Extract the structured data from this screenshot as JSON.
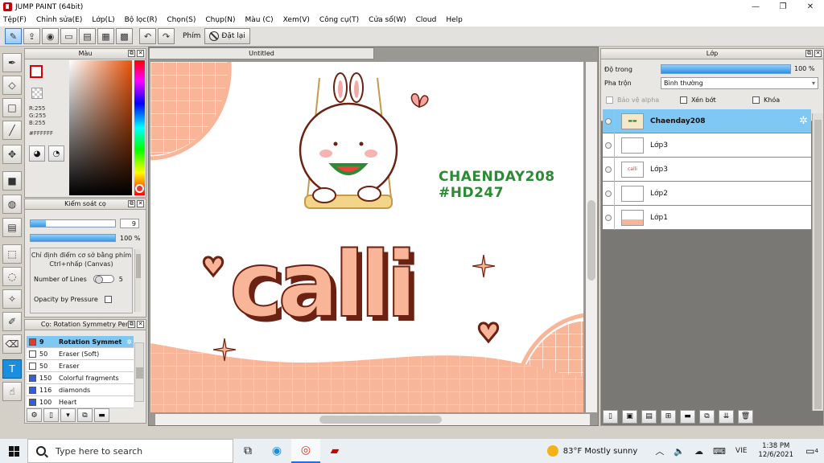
{
  "window": {
    "title": "JUMP PAINT (64bit)",
    "minimize": "—",
    "maximize": "❐",
    "close": "✕"
  },
  "menu": [
    "Tệp(F)",
    "Chỉnh sửa(E)",
    "Lớp(L)",
    "Bộ lọc(R)",
    "Chọn(S)",
    "Chụp(N)",
    "Màu (C)",
    "Xem(V)",
    "Công cụ(T)",
    "Cửa sổ(W)",
    "Cloud",
    "Help"
  ],
  "toolbar": {
    "key_label": "Phím",
    "reset_label": "Đặt lại"
  },
  "color_panel": {
    "title": "Màu",
    "r": "R:255",
    "g": "G:255",
    "b": "B:255",
    "hex": "#FFFFFF",
    "primary_color": "#FFFFFF",
    "hue_color": "#E8540A"
  },
  "brush_control": {
    "title": "Kiểm soát cọ",
    "size_value": "9",
    "size_fraction": 0.18,
    "opacity_value": "100 %",
    "opacity_fraction": 1.0,
    "description": "Chỉ định điểm cơ sở bằng phím Ctrl+nhấp (Canvas)",
    "lines_label": "Number of Lines",
    "lines_value": "5",
    "pressure_label": "Opacity by Pressure"
  },
  "brush_list": {
    "title": "Cọ: Rotation Symmetry Pen",
    "items": [
      {
        "color": "#E8392F",
        "size": "9",
        "name": "Rotation Symmet",
        "selected": true
      },
      {
        "color": "#FFFFFF",
        "size": "50",
        "name": "Eraser (Soft)",
        "selected": false
      },
      {
        "color": "#FFFFFF",
        "size": "50",
        "name": "Eraser",
        "selected": false
      },
      {
        "color": "#2F5FE8",
        "size": "150",
        "name": "Colorful fragments",
        "selected": false
      },
      {
        "color": "#2F5FE8",
        "size": "116",
        "name": "diamonds",
        "selected": false
      },
      {
        "color": "#2F5FE8",
        "size": "100",
        "name": "Heart",
        "selected": false
      }
    ]
  },
  "canvas": {
    "tab_label": "Untitled",
    "text_line1": "CHAENDAY208",
    "text_line2": "#HD247",
    "art_word": "calli",
    "text_color": "#2D8A34",
    "peach": "#F9B597",
    "dark": "#6B2212"
  },
  "layers": {
    "title": "Lớp",
    "opacity_label": "Độ trong",
    "opacity_value": "100 %",
    "blend_label": "Pha trộn",
    "blend_value": "Bình thường",
    "protect_alpha": "Bảo vệ alpha",
    "clipping": "Xén bớt",
    "lock": "Khóa",
    "items": [
      {
        "name": "Chaenday208",
        "selected": true,
        "thumb": ""
      },
      {
        "name": "Lớp3",
        "selected": false,
        "thumb": ""
      },
      {
        "name": "Lớp3",
        "selected": false,
        "thumb": "calli"
      },
      {
        "name": "Lớp2",
        "selected": false,
        "thumb": ""
      },
      {
        "name": "Lớp1",
        "selected": false,
        "thumb": ""
      }
    ]
  },
  "taskbar": {
    "search_placeholder": "Type here to search",
    "weather": "83°F  Mostly sunny",
    "lang": "VIE",
    "time": "1:38 PM",
    "date": "12/6/2021",
    "notifications": "4"
  }
}
